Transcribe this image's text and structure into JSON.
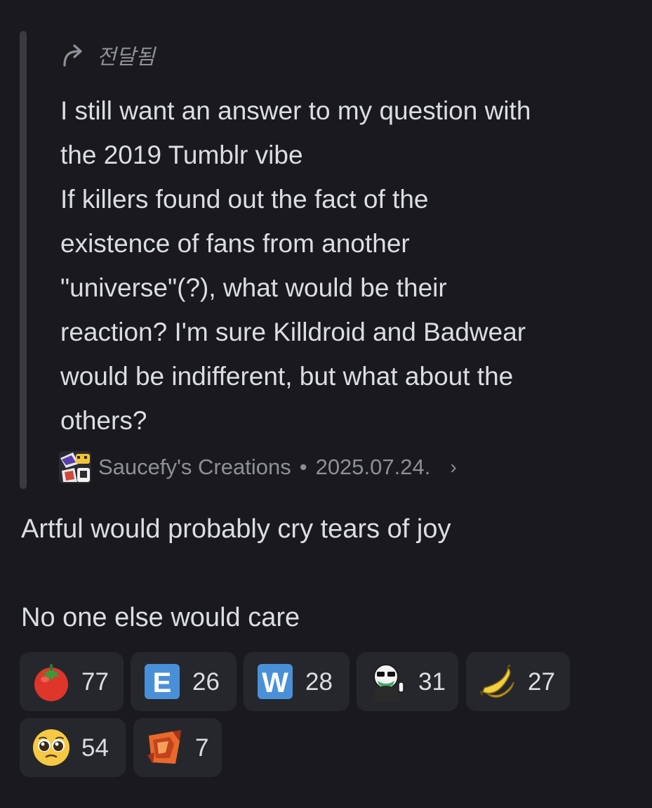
{
  "forwarded": {
    "label": "전달됨",
    "text": "I still want an answer to my question with\nthe 2019 Tumblr vibe\nIf killers found out the fact of the\nexistence of fans from another\n\"universe\"(?), what would be their\nreaction? I'm sure Killdroid and Badwear\nwould be indifferent, but what about the\nothers?",
    "source_name": "Saucefy's Creations",
    "separator": "•",
    "date": "2025.07.24.",
    "chevron": "›"
  },
  "message": {
    "text": "Artful would probably cry tears of joy\n\nNo one else would care"
  },
  "reactions": [
    {
      "icon": "tomato-icon",
      "count": "77"
    },
    {
      "icon": "letter-e-icon",
      "letter": "E",
      "count": "26"
    },
    {
      "icon": "letter-w-icon",
      "letter": "W",
      "count": "28"
    },
    {
      "icon": "masked-character-icon",
      "count": "31"
    },
    {
      "icon": "banana-icon",
      "count": "27"
    },
    {
      "icon": "pleading-face-icon",
      "count": "54"
    },
    {
      "icon": "orange-sticker-icon",
      "count": "7"
    }
  ],
  "colors": {
    "background": "#1a1a1e",
    "text": "#dbdee1",
    "muted": "#8e9097",
    "reaction_bg": "#26272c",
    "letter_tile": "#4a90d9"
  }
}
